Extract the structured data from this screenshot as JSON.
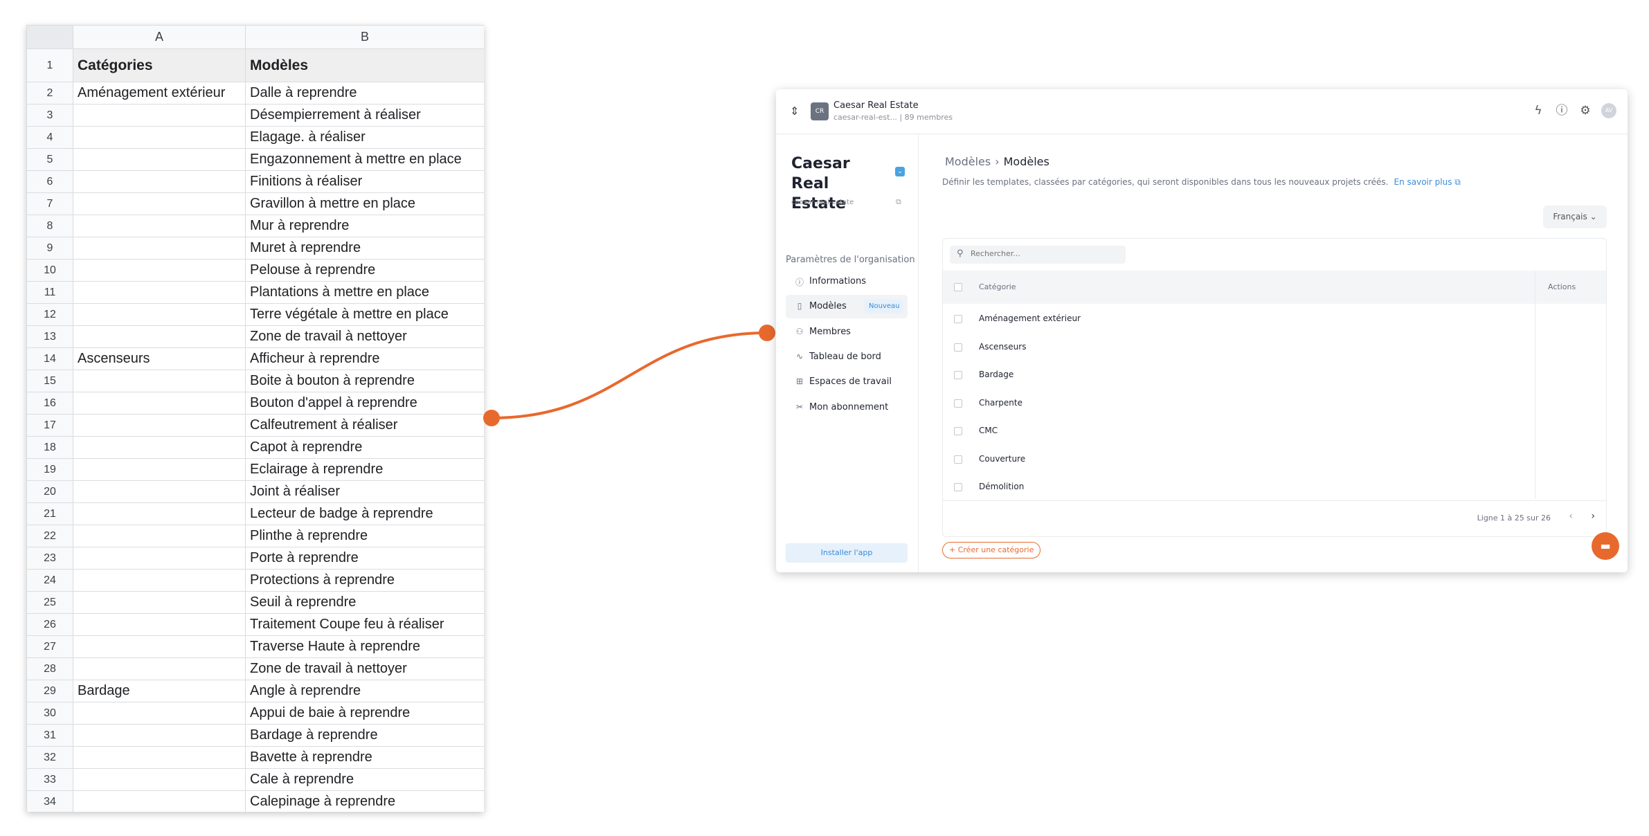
{
  "spreadsheet": {
    "columns": [
      "A",
      "B"
    ],
    "header_row": {
      "num": "1",
      "a": "Catégories",
      "b": "Modèles"
    },
    "rows": [
      {
        "num": "2",
        "a": "Aménagement extérieur",
        "b": "Dalle à reprendre"
      },
      {
        "num": "3",
        "a": "",
        "b": "Désempierrement à réaliser"
      },
      {
        "num": "4",
        "a": "",
        "b": "Elagage. à réaliser"
      },
      {
        "num": "5",
        "a": "",
        "b": "Engazonnement à mettre en place"
      },
      {
        "num": "6",
        "a": "",
        "b": "Finitions à réaliser"
      },
      {
        "num": "7",
        "a": "",
        "b": "Gravillon à mettre en place"
      },
      {
        "num": "8",
        "a": "",
        "b": "Mur à reprendre"
      },
      {
        "num": "9",
        "a": "",
        "b": "Muret à reprendre"
      },
      {
        "num": "10",
        "a": "",
        "b": "Pelouse à reprendre"
      },
      {
        "num": "11",
        "a": "",
        "b": "Plantations à mettre en place"
      },
      {
        "num": "12",
        "a": "",
        "b": "Terre végétale à mettre en place"
      },
      {
        "num": "13",
        "a": "",
        "b": "Zone de travail à nettoyer"
      },
      {
        "num": "14",
        "a": "Ascenseurs",
        "b": "Afficheur à reprendre"
      },
      {
        "num": "15",
        "a": "",
        "b": "Boite à bouton à reprendre"
      },
      {
        "num": "16",
        "a": "",
        "b": "Bouton d'appel à reprendre"
      },
      {
        "num": "17",
        "a": "",
        "b": "Calfeutrement à réaliser"
      },
      {
        "num": "18",
        "a": "",
        "b": "Capot à reprendre"
      },
      {
        "num": "19",
        "a": "",
        "b": "Eclairage à reprendre"
      },
      {
        "num": "20",
        "a": "",
        "b": "Joint à réaliser"
      },
      {
        "num": "21",
        "a": "",
        "b": "Lecteur de badge à reprendre"
      },
      {
        "num": "22",
        "a": "",
        "b": "Plinthe à reprendre"
      },
      {
        "num": "23",
        "a": "",
        "b": "Porte à reprendre"
      },
      {
        "num": "24",
        "a": "",
        "b": "Protections  à reprendre"
      },
      {
        "num": "25",
        "a": "",
        "b": "Seuil à reprendre"
      },
      {
        "num": "26",
        "a": "",
        "b": "Traitement Coupe feu à réaliser"
      },
      {
        "num": "27",
        "a": "",
        "b": "Traverse Haute à reprendre"
      },
      {
        "num": "28",
        "a": "",
        "b": "Zone de travail à nettoyer"
      },
      {
        "num": "29",
        "a": "Bardage",
        "b": "Angle à reprendre"
      },
      {
        "num": "30",
        "a": "",
        "b": "Appui de baie à reprendre"
      },
      {
        "num": "31",
        "a": "",
        "b": "Bardage à reprendre"
      },
      {
        "num": "32",
        "a": "",
        "b": "Bavette à reprendre"
      },
      {
        "num": "33",
        "a": "",
        "b": "Cale à reprendre"
      },
      {
        "num": "34",
        "a": "",
        "b": "Calepinage à reprendre"
      }
    ]
  },
  "connector_color": "#e8692d",
  "app": {
    "topbar": {
      "logo": "CR",
      "org_name": "Caesar Real Estate",
      "org_sub": "caesar-real-est... | 89 membres",
      "avatar": "AV",
      "icons": [
        "swap-icon",
        "bolt-icon",
        "help-icon",
        "gear-icon"
      ]
    },
    "sidebar": {
      "workspace_title": "Caesar Real Estate",
      "workspace_badge": "⌄",
      "workspace_slug": "caesar-real-estate",
      "section_title": "Paramètres de l'organisation",
      "items": [
        {
          "label": "Informations",
          "icon": "info-icon"
        },
        {
          "label": "Modèles",
          "icon": "book-icon",
          "tag": "Nouveau",
          "active": true
        },
        {
          "label": "Membres",
          "icon": "users-icon"
        },
        {
          "label": "Tableau de bord",
          "icon": "activity-icon"
        },
        {
          "label": "Espaces de travail",
          "icon": "grid-icon"
        },
        {
          "label": "Mon abonnement",
          "icon": "scissors-icon"
        }
      ],
      "install_label": "Installer l'app"
    },
    "main": {
      "breadcrumb": [
        "Modèles",
        "Modèles"
      ],
      "description": "Définir les templates, classées par catégories, qui seront disponibles dans tous les nouveaux projets créés.",
      "learn_more": "En savoir plus",
      "language": "Français",
      "search_placeholder": "Rechercher...",
      "columns": {
        "category": "Catégorie",
        "actions": "Actions"
      },
      "rows": [
        "Aménagement extérieur",
        "Ascenseurs",
        "Bardage",
        "Charpente",
        "CMC",
        "Couverture",
        "Démolition"
      ],
      "pagination": "Ligne 1 à 25 sur 26",
      "create_button": "Créer une catégorie"
    },
    "accent_color": "#e8692d",
    "link_color": "#3a8ad8"
  }
}
